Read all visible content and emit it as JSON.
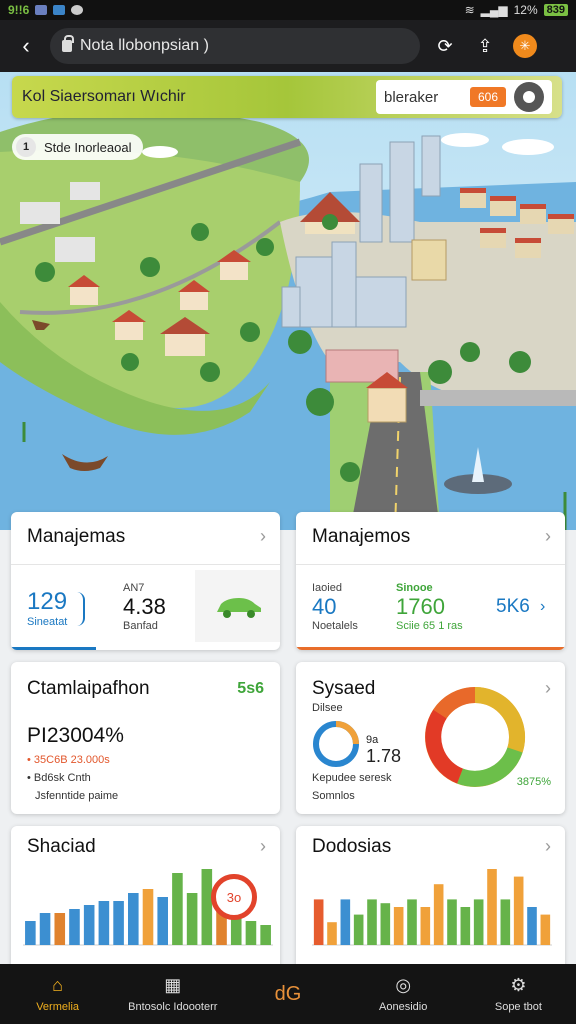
{
  "status": {
    "carrier": "9!!6",
    "signal_text": "12%",
    "battery": "839"
  },
  "browser": {
    "url": "Nota llobonpsian )"
  },
  "banner": {
    "title": "Kol  Siaersomarı Wıchir",
    "box_label": "bleraker",
    "box_button": "606"
  },
  "location_pill": {
    "text": "Stde Inorleaoal",
    "icon": "1"
  },
  "cards": {
    "c1": {
      "title": "Manajemas",
      "v1": "129",
      "v1_sub": "Sineatat",
      "v2_top": "AN7",
      "v2": "4.38",
      "v2_sub": "Banfad",
      "icon": "car-icon"
    },
    "c2": {
      "title": "Manajemos",
      "v1_top": "Iaoied",
      "v1": "40",
      "v1_sub": "Noetalels",
      "v2_top": "Sinooe",
      "v2": "1760",
      "v2_sub": "Sciie 65 1 ras",
      "v3": "5K6"
    },
    "c3": {
      "title": "Ctamlaipafhon",
      "badge": "5s6",
      "big": "PI23004%",
      "line1": "35C6B 23.000s",
      "line2": "Bd6sk Cnth",
      "line3": "Jsfenntide paime"
    },
    "c4": {
      "title": "Sysaed",
      "sub": "Dilsee",
      "ring_a": "9a",
      "ring_b": "1.78",
      "note1": "Kepudee seresk",
      "note2": "Somnlos",
      "pct": "3875%"
    },
    "c5": {
      "title": "Shaciad",
      "badge": "3o"
    },
    "c6": {
      "title": "Dodosias"
    }
  },
  "chart_data": [
    {
      "type": "bar",
      "title": "Shaciad",
      "values": [
        3,
        4,
        4,
        4.5,
        5,
        5.5,
        5.5,
        6.5,
        7,
        6,
        9,
        6.5,
        9.5,
        5.5,
        4,
        3,
        2.5
      ],
      "colors": [
        "#3c8fd1",
        "#3c8fd1",
        "#e0832f",
        "#3c8fd1",
        "#3c8fd1",
        "#3c8fd1",
        "#3c8fd1",
        "#3c8fd1",
        "#f0a13a",
        "#3c8fd1",
        "#66b34a",
        "#66b34a",
        "#66b34a",
        "#e0832f",
        "#66b34a",
        "#66b34a",
        "#66b34a"
      ]
    },
    {
      "type": "bar",
      "title": "Dodosias",
      "values": [
        6,
        3,
        6,
        4,
        6,
        5.5,
        5,
        6,
        5,
        8,
        6,
        5,
        6,
        10,
        6,
        9,
        5,
        4
      ],
      "colors": [
        "#e65c2e",
        "#f0a13a",
        "#3c8fd1",
        "#66b34a",
        "#66b34a",
        "#66b34a",
        "#f0a13a",
        "#66b34a",
        "#f0a13a",
        "#f0a13a",
        "#66b34a",
        "#66b34a",
        "#66b34a",
        "#f0a13a",
        "#66b34a",
        "#f0a13a",
        "#3c8fd1",
        "#f0a13a"
      ]
    }
  ],
  "nav": [
    {
      "label": "Vermelia",
      "icon": "home-icon"
    },
    {
      "label": "Bntosolc Idoooterr",
      "icon": "calendar-icon"
    },
    {
      "label": "dG",
      "icon": "pin-icon"
    },
    {
      "label": "Aonesidio",
      "icon": "compass-icon"
    },
    {
      "label": "Sope tbot",
      "icon": "settings-icon"
    }
  ],
  "colors": {
    "accent_orange": "#f07826",
    "lime": "#b5cc40",
    "blue": "#1a78c2",
    "green": "#3fa53a"
  }
}
